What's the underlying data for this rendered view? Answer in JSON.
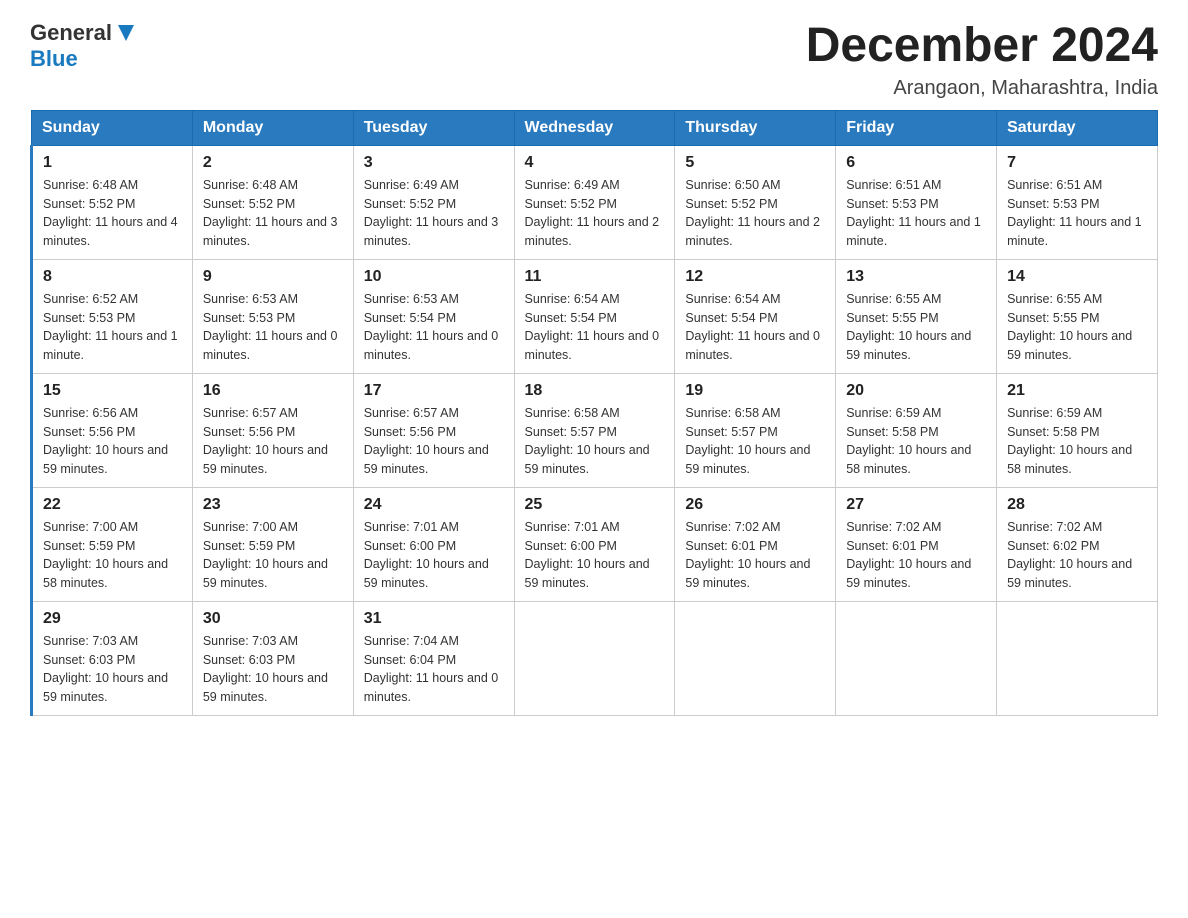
{
  "header": {
    "logo_general": "General",
    "logo_blue": "Blue",
    "month_title": "December 2024",
    "location": "Arangaon, Maharashtra, India"
  },
  "days_of_week": [
    "Sunday",
    "Monday",
    "Tuesday",
    "Wednesday",
    "Thursday",
    "Friday",
    "Saturday"
  ],
  "weeks": [
    [
      {
        "day": "1",
        "sunrise": "6:48 AM",
        "sunset": "5:52 PM",
        "daylight": "11 hours and 4 minutes."
      },
      {
        "day": "2",
        "sunrise": "6:48 AM",
        "sunset": "5:52 PM",
        "daylight": "11 hours and 3 minutes."
      },
      {
        "day": "3",
        "sunrise": "6:49 AM",
        "sunset": "5:52 PM",
        "daylight": "11 hours and 3 minutes."
      },
      {
        "day": "4",
        "sunrise": "6:49 AM",
        "sunset": "5:52 PM",
        "daylight": "11 hours and 2 minutes."
      },
      {
        "day": "5",
        "sunrise": "6:50 AM",
        "sunset": "5:52 PM",
        "daylight": "11 hours and 2 minutes."
      },
      {
        "day": "6",
        "sunrise": "6:51 AM",
        "sunset": "5:53 PM",
        "daylight": "11 hours and 1 minute."
      },
      {
        "day": "7",
        "sunrise": "6:51 AM",
        "sunset": "5:53 PM",
        "daylight": "11 hours and 1 minute."
      }
    ],
    [
      {
        "day": "8",
        "sunrise": "6:52 AM",
        "sunset": "5:53 PM",
        "daylight": "11 hours and 1 minute."
      },
      {
        "day": "9",
        "sunrise": "6:53 AM",
        "sunset": "5:53 PM",
        "daylight": "11 hours and 0 minutes."
      },
      {
        "day": "10",
        "sunrise": "6:53 AM",
        "sunset": "5:54 PM",
        "daylight": "11 hours and 0 minutes."
      },
      {
        "day": "11",
        "sunrise": "6:54 AM",
        "sunset": "5:54 PM",
        "daylight": "11 hours and 0 minutes."
      },
      {
        "day": "12",
        "sunrise": "6:54 AM",
        "sunset": "5:54 PM",
        "daylight": "11 hours and 0 minutes."
      },
      {
        "day": "13",
        "sunrise": "6:55 AM",
        "sunset": "5:55 PM",
        "daylight": "10 hours and 59 minutes."
      },
      {
        "day": "14",
        "sunrise": "6:55 AM",
        "sunset": "5:55 PM",
        "daylight": "10 hours and 59 minutes."
      }
    ],
    [
      {
        "day": "15",
        "sunrise": "6:56 AM",
        "sunset": "5:56 PM",
        "daylight": "10 hours and 59 minutes."
      },
      {
        "day": "16",
        "sunrise": "6:57 AM",
        "sunset": "5:56 PM",
        "daylight": "10 hours and 59 minutes."
      },
      {
        "day": "17",
        "sunrise": "6:57 AM",
        "sunset": "5:56 PM",
        "daylight": "10 hours and 59 minutes."
      },
      {
        "day": "18",
        "sunrise": "6:58 AM",
        "sunset": "5:57 PM",
        "daylight": "10 hours and 59 minutes."
      },
      {
        "day": "19",
        "sunrise": "6:58 AM",
        "sunset": "5:57 PM",
        "daylight": "10 hours and 59 minutes."
      },
      {
        "day": "20",
        "sunrise": "6:59 AM",
        "sunset": "5:58 PM",
        "daylight": "10 hours and 58 minutes."
      },
      {
        "day": "21",
        "sunrise": "6:59 AM",
        "sunset": "5:58 PM",
        "daylight": "10 hours and 58 minutes."
      }
    ],
    [
      {
        "day": "22",
        "sunrise": "7:00 AM",
        "sunset": "5:59 PM",
        "daylight": "10 hours and 58 minutes."
      },
      {
        "day": "23",
        "sunrise": "7:00 AM",
        "sunset": "5:59 PM",
        "daylight": "10 hours and 59 minutes."
      },
      {
        "day": "24",
        "sunrise": "7:01 AM",
        "sunset": "6:00 PM",
        "daylight": "10 hours and 59 minutes."
      },
      {
        "day": "25",
        "sunrise": "7:01 AM",
        "sunset": "6:00 PM",
        "daylight": "10 hours and 59 minutes."
      },
      {
        "day": "26",
        "sunrise": "7:02 AM",
        "sunset": "6:01 PM",
        "daylight": "10 hours and 59 minutes."
      },
      {
        "day": "27",
        "sunrise": "7:02 AM",
        "sunset": "6:01 PM",
        "daylight": "10 hours and 59 minutes."
      },
      {
        "day": "28",
        "sunrise": "7:02 AM",
        "sunset": "6:02 PM",
        "daylight": "10 hours and 59 minutes."
      }
    ],
    [
      {
        "day": "29",
        "sunrise": "7:03 AM",
        "sunset": "6:03 PM",
        "daylight": "10 hours and 59 minutes."
      },
      {
        "day": "30",
        "sunrise": "7:03 AM",
        "sunset": "6:03 PM",
        "daylight": "10 hours and 59 minutes."
      },
      {
        "day": "31",
        "sunrise": "7:04 AM",
        "sunset": "6:04 PM",
        "daylight": "11 hours and 0 minutes."
      },
      null,
      null,
      null,
      null
    ]
  ]
}
